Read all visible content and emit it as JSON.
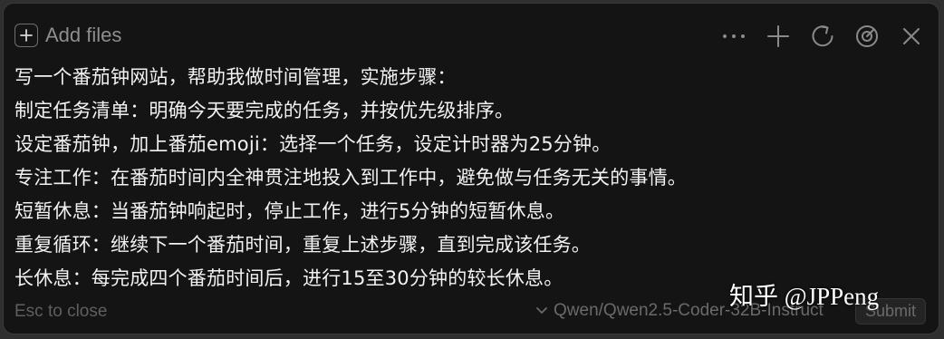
{
  "panel": {
    "add_files_label": "Add files",
    "toolbar_icons": [
      "more-icon",
      "plus-icon",
      "refresh-icon",
      "gauge-icon",
      "close-icon"
    ]
  },
  "prompt": {
    "lines": [
      "写一个番茄钟网站，帮助我做时间管理，实施步骤：",
      "制定任务清单：明确今天要完成的任务，并按优先级排序。",
      "设定番茄钟，加上番茄emoji：选择一个任务，设定计时器为25分钟。",
      "专注工作：在番茄时间内全神贯注地投入到工作中，避免做与任务无关的事情。",
      "短暂休息：当番茄钟响起时，停止工作，进行5分钟的短暂休息。",
      "重复循环：继续下一个番茄时间，重复上述步骤，直到完成该任务。",
      "长休息：每完成四个番茄时间后，进行15至30分钟的较长休息。"
    ]
  },
  "footer": {
    "esc_hint": "Esc to close",
    "model": "Qwen/Qwen2.5-Coder-32B-Instruct",
    "submit_label": "Submit"
  },
  "watermark": {
    "text": "知乎 @JPPeng"
  },
  "colors": {
    "background": "#141414",
    "text": "#f2f2f2",
    "muted": "#8e8e8e",
    "dim": "#5f5f5f"
  }
}
